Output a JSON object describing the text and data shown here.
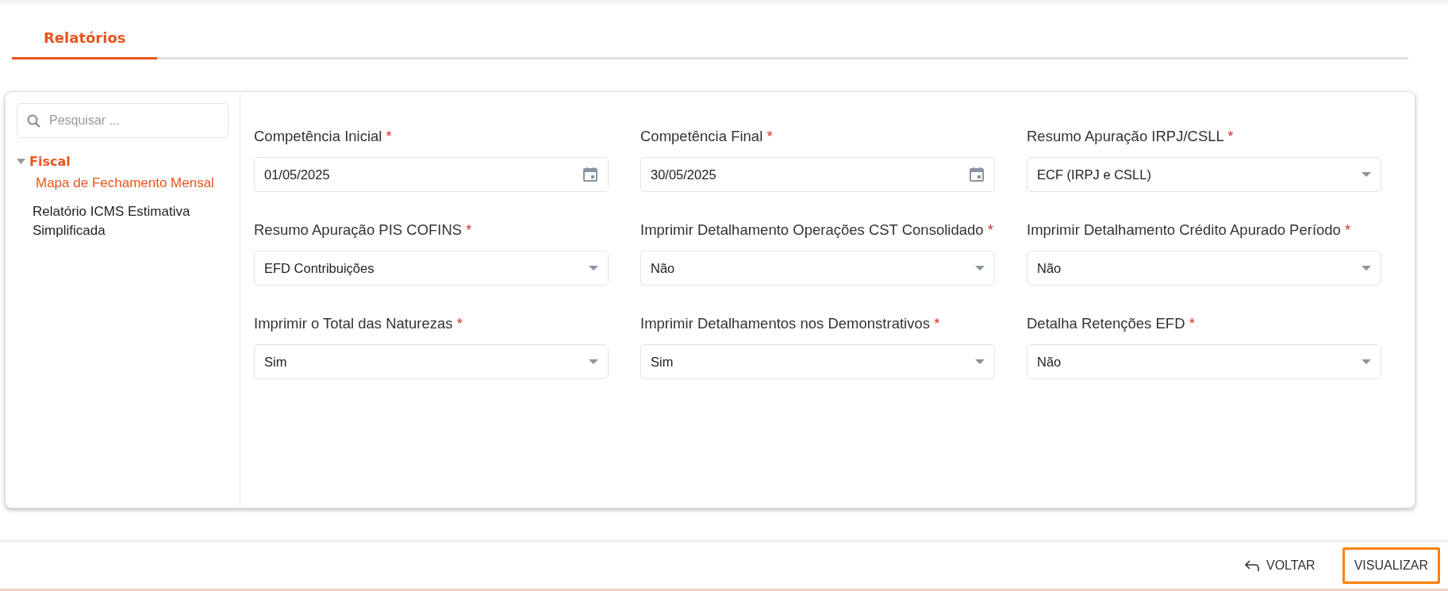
{
  "tabs": [
    {
      "label": "Relatórios",
      "selected": true
    }
  ],
  "search": {
    "placeholder": "Pesquisar ..."
  },
  "tree": [
    {
      "label": "Fiscal",
      "expanded": true,
      "children": [
        {
          "label": "Mapa de Fechamento Mensal",
          "selected": true
        },
        {
          "label": "Relatório ICMS Estimativa Simplificada",
          "selected": false
        }
      ]
    }
  ],
  "fields": [
    {
      "label": "Competência Inicial",
      "required": true,
      "kind": "date",
      "value": "01/05/2025"
    },
    {
      "label": "Competência Final",
      "required": true,
      "kind": "date",
      "value": "30/05/2025"
    },
    {
      "label": "Resumo Apuração IRPJ/CSLL",
      "required": true,
      "kind": "select",
      "value": "ECF (IRPJ e CSLL)"
    },
    {
      "label": "Resumo Apuração PIS COFINS",
      "required": true,
      "kind": "select",
      "value": "EFD Contribuições"
    },
    {
      "label": "Imprimir Detalhamento Operações CST Consolidado",
      "required": true,
      "kind": "select",
      "value": "Não"
    },
    {
      "label": "Imprimir Detalhamento Crédito Apurado Período",
      "required": true,
      "kind": "select",
      "value": "Não"
    },
    {
      "label": "Imprimir o Total das Naturezas",
      "required": true,
      "kind": "select",
      "value": "Sim"
    },
    {
      "label": "Imprimir Detalhamentos nos Demonstrativos",
      "required": true,
      "kind": "select",
      "value": "Sim"
    },
    {
      "label": "Detalha Retenções EFD",
      "required": true,
      "kind": "select",
      "value": "Não"
    }
  ],
  "required_mark": "*",
  "footer": {
    "back": "VOLTAR",
    "view": "VISUALIZAR"
  }
}
